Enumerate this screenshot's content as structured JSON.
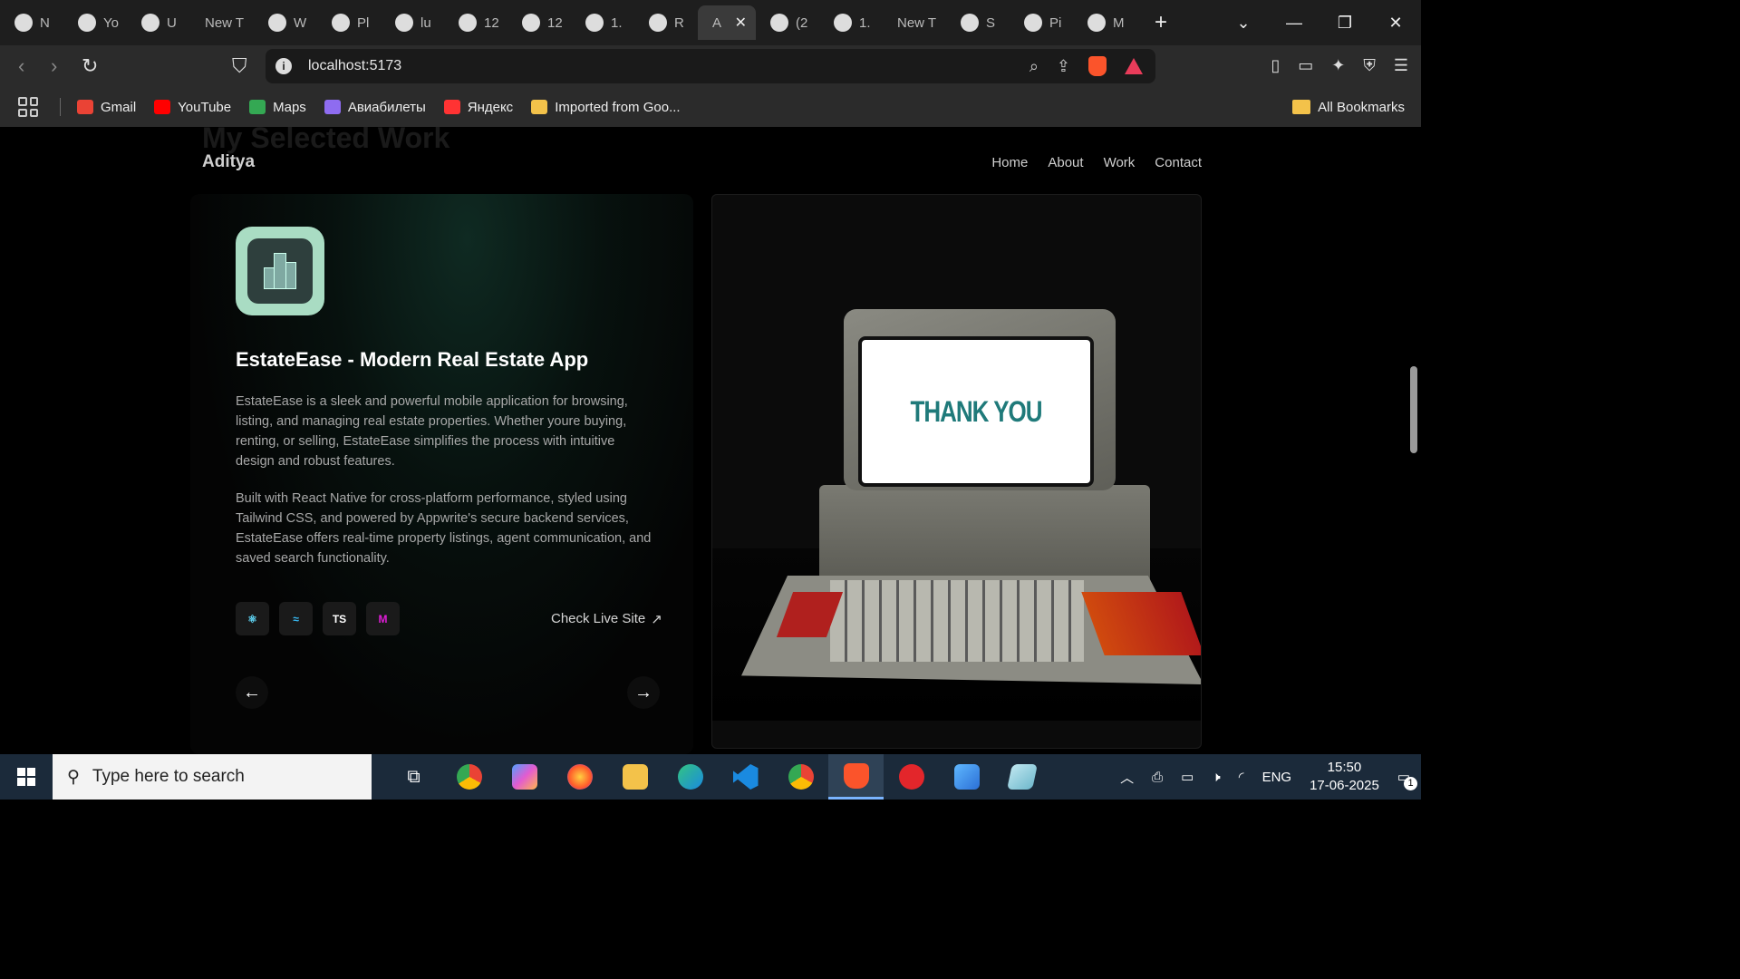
{
  "browser": {
    "tabs": [
      {
        "title": "N",
        "icon": "openai-icon"
      },
      {
        "title": "Yo",
        "icon": "github-icon"
      },
      {
        "title": "U",
        "icon": "udemy-icon"
      },
      {
        "title": "New T",
        "icon": ""
      },
      {
        "title": "W",
        "icon": "whatsapp-icon"
      },
      {
        "title": "Pl",
        "icon": "pngsvg-icon"
      },
      {
        "title": "lu",
        "icon": "github-icon"
      },
      {
        "title": "12",
        "icon": "globe-icon"
      },
      {
        "title": "12",
        "icon": "globe-icon"
      },
      {
        "title": "1.",
        "icon": "bars-icon"
      },
      {
        "title": "R",
        "icon": "claude-icon"
      },
      {
        "title": "A",
        "icon": "",
        "active": true
      },
      {
        "title": "(2",
        "icon": "youtube-icon"
      },
      {
        "title": "1.",
        "icon": "globe-icon"
      },
      {
        "title": "New T",
        "icon": ""
      },
      {
        "title": "S",
        "icon": "canva-icon"
      },
      {
        "title": "Pi",
        "icon": "canva-icon"
      },
      {
        "title": "M",
        "icon": "openai-icon"
      }
    ],
    "url": "localhost:5173",
    "bookmarks": [
      {
        "label": "Gmail",
        "color": "#ea4335"
      },
      {
        "label": "YouTube",
        "color": "#ff0000"
      },
      {
        "label": "Maps",
        "color": "#34a853"
      },
      {
        "label": "Авиабилеты",
        "color": "#8e6cf0"
      },
      {
        "label": "Яндекс",
        "color": "#ff3333"
      },
      {
        "label": "Imported from Goo...",
        "color": "#f3c24a"
      }
    ],
    "all_bookmarks": "All Bookmarks"
  },
  "site": {
    "ghost_heading": "My Selected Work",
    "logo": "Aditya",
    "nav": [
      "Home",
      "About",
      "Work",
      "Contact"
    ],
    "project": {
      "title": "EstateEase - Modern Real Estate App",
      "description_1": "EstateEase is a sleek and powerful mobile application for browsing, listing, and managing real estate properties. Whether youre buying, renting, or selling, EstateEase simplifies the process with intuitive design and robust features.",
      "description_2": "Built with React Native for cross-platform performance, styled using Tailwind CSS, and powered by Appwrite's secure backend services, EstateEase offers real-time property listings, agent communication, and saved search functionality.",
      "tech": [
        {
          "name": "react-icon",
          "glyph": "⚛",
          "color": "#61dafb"
        },
        {
          "name": "tailwind-icon",
          "glyph": "≈",
          "color": "#38bdf8"
        },
        {
          "name": "typescript-icon",
          "glyph": "TS",
          "color": "#ffffff"
        },
        {
          "name": "motion-icon",
          "glyph": "M",
          "color": "#e11dd8"
        }
      ],
      "live_link": "Check Live Site",
      "screen_text": "THANK YOU"
    }
  },
  "taskbar": {
    "search_placeholder": "Type here to search",
    "language": "ENG",
    "time": "15:50",
    "date": "17-06-2025",
    "notifications": "1"
  }
}
